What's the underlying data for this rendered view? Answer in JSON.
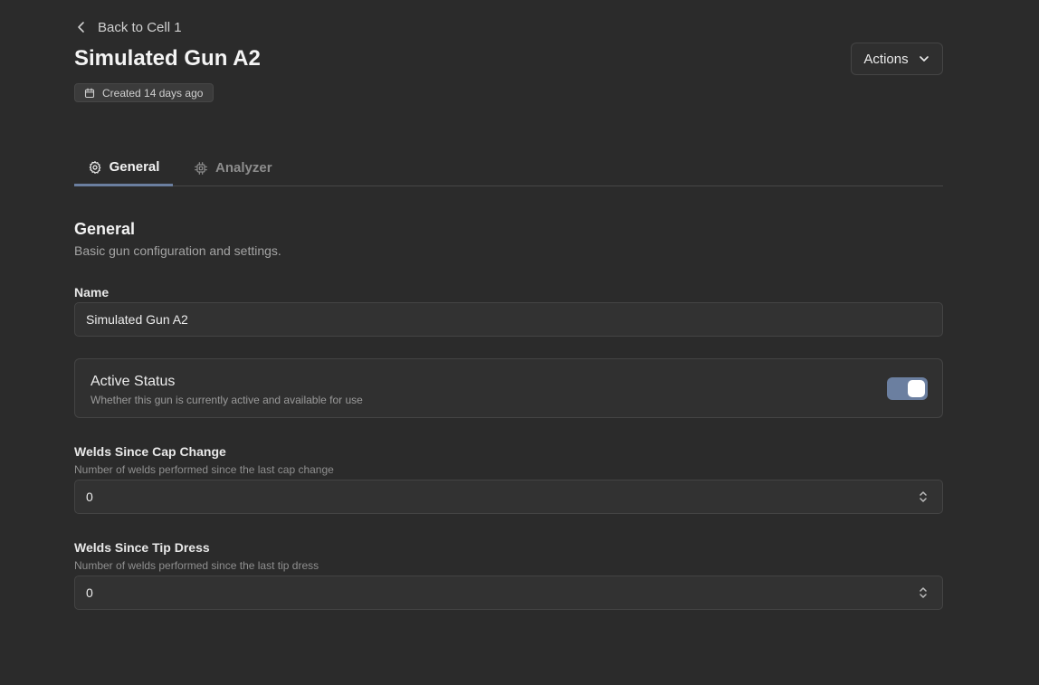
{
  "header": {
    "back_label": "Back to Cell 1",
    "title": "Simulated Gun A2",
    "created_label": "Created 14 days ago",
    "actions_label": "Actions"
  },
  "tabs": [
    {
      "label": "General",
      "icon": "gear-icon",
      "active": true
    },
    {
      "label": "Analyzer",
      "icon": "cpu-icon",
      "active": false
    }
  ],
  "section": {
    "title": "General",
    "description": "Basic gun configuration and settings."
  },
  "fields": {
    "name": {
      "label": "Name",
      "value": "Simulated Gun A2"
    },
    "active_status": {
      "title": "Active Status",
      "description": "Whether this gun is currently active and available for use",
      "enabled": true
    },
    "welds_cap_change": {
      "label": "Welds Since Cap Change",
      "help": "Number of welds performed since the last cap change",
      "value": "0"
    },
    "welds_tip_dress": {
      "label": "Welds Since Tip Dress",
      "help": "Number of welds performed since the last tip dress",
      "value": "0"
    }
  },
  "colors": {
    "background": "#2b2b2b",
    "accent": "#6b7fa0",
    "border": "#444444"
  }
}
